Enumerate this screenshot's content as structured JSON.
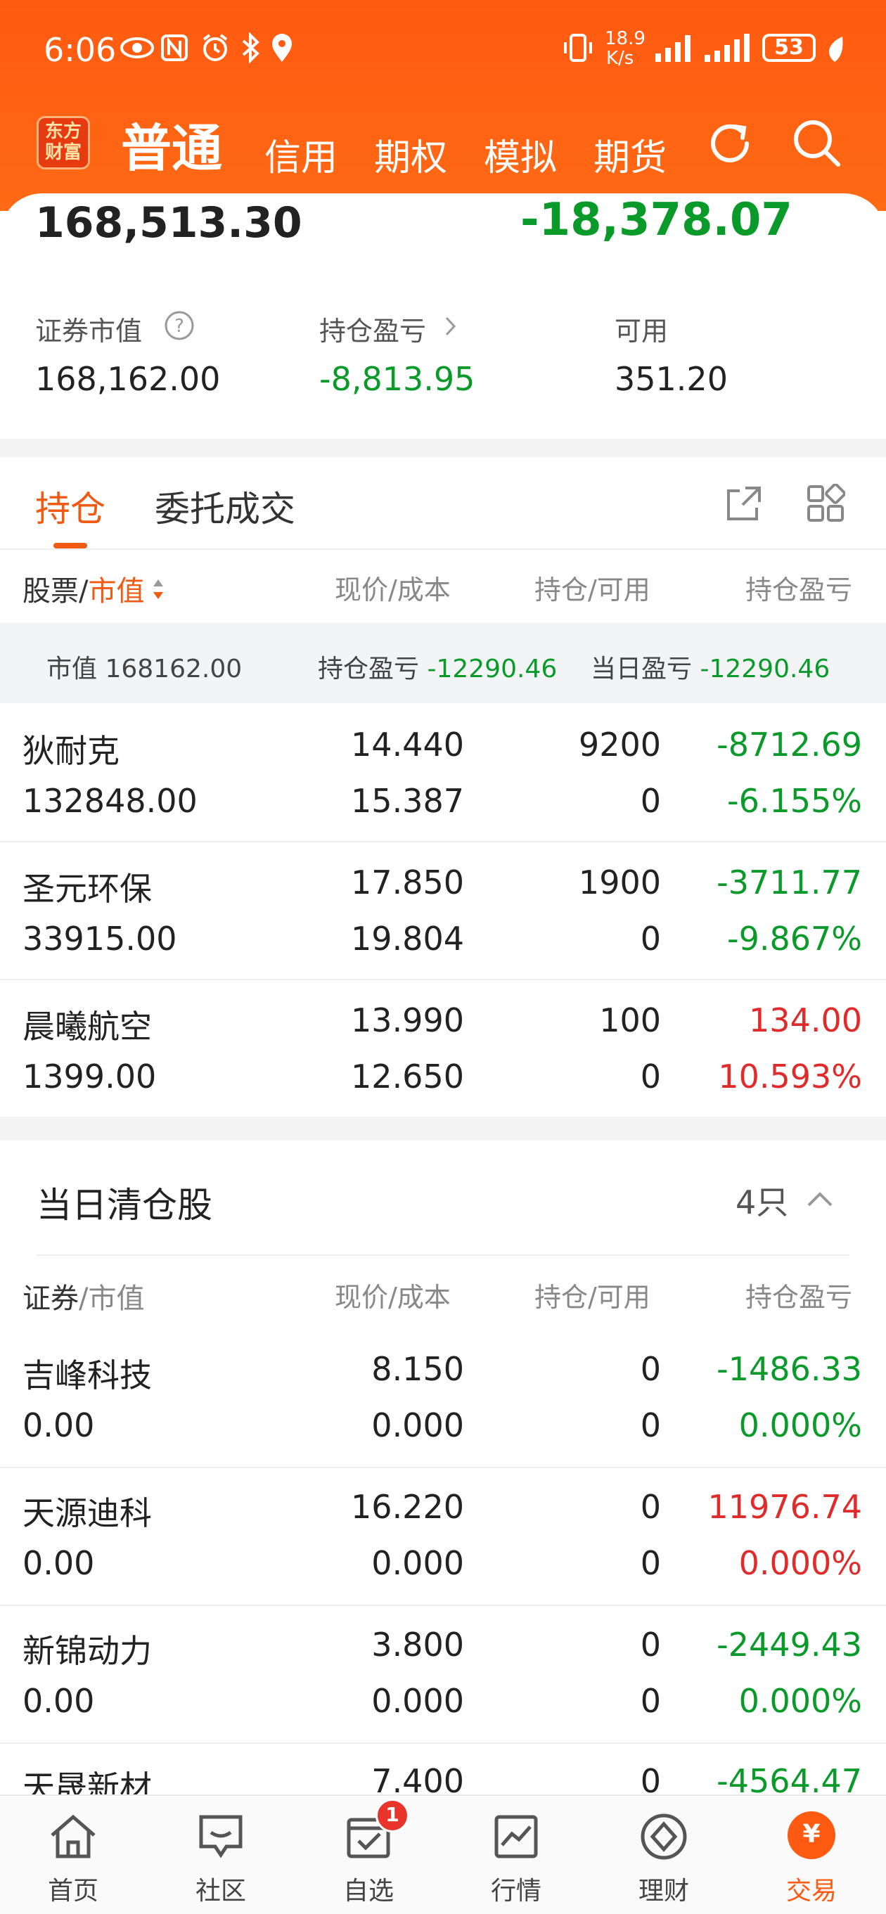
{
  "status_bar": {
    "time": "6:06",
    "net_speed_top": "18.9",
    "net_speed_bottom": "K/s",
    "battery": "53"
  },
  "nav": {
    "logo_line1": "东方",
    "logo_line2": "财富",
    "tabs": [
      "普通",
      "信用",
      "期权",
      "模拟",
      "期货"
    ]
  },
  "summary": {
    "total_assets": "168,513.30",
    "day_pnl": "-18,378.07",
    "market_value_label": "证券市值",
    "market_value": "168,162.00",
    "position_pnl_label": "持仓盈亏",
    "position_pnl": "-8,813.95",
    "available_label": "可用",
    "available": "351.20"
  },
  "tabs": {
    "holdings": "持仓",
    "orders": "委托成交"
  },
  "holdings_header": {
    "col1_a": "股票",
    "col1_sep": "/",
    "col1_b": "市值",
    "col2": "现价/成本",
    "col3": "持仓/可用",
    "col4": "持仓盈亏"
  },
  "holdings_summary": {
    "mv_label": "市值",
    "mv": "168162.00",
    "pos_label": "持仓盈亏",
    "pos": "-12290.46",
    "day_label": "当日盈亏",
    "day": "-12290.46"
  },
  "holdings": [
    {
      "name": "狄耐克",
      "market_value": "132848.00",
      "price": "14.440",
      "cost": "15.387",
      "qty": "9200",
      "avail": "0",
      "pnl": "-8712.69",
      "pnl_pct": "-6.155%"
    },
    {
      "name": "圣元环保",
      "market_value": "33915.00",
      "price": "17.850",
      "cost": "19.804",
      "qty": "1900",
      "avail": "0",
      "pnl": "-3711.77",
      "pnl_pct": "-9.867%"
    },
    {
      "name": "晨曦航空",
      "market_value": "1399.00",
      "price": "13.990",
      "cost": "12.650",
      "qty": "100",
      "avail": "0",
      "pnl": "134.00",
      "pnl_pct": "10.593%"
    }
  ],
  "cleared": {
    "title": "当日清仓股",
    "count": "4只",
    "header": {
      "col1_a": "证券",
      "col1_sep": "/",
      "col1_b": "市值",
      "col2": "现价/成本",
      "col3": "持仓/可用",
      "col4": "持仓盈亏"
    },
    "rows": [
      {
        "name": "吉峰科技",
        "market_value": "0.00",
        "price": "8.150",
        "cost": "0.000",
        "qty": "0",
        "avail": "0",
        "pnl": "-1486.33",
        "pnl_pct": "0.000%"
      },
      {
        "name": "天源迪科",
        "market_value": "0.00",
        "price": "16.220",
        "cost": "0.000",
        "qty": "0",
        "avail": "0",
        "pnl": "11976.74",
        "pnl_pct": "0.000%"
      },
      {
        "name": "新锦动力",
        "market_value": "0.00",
        "price": "3.800",
        "cost": "0.000",
        "qty": "0",
        "avail": "0",
        "pnl": "-2449.43",
        "pnl_pct": "0.000%"
      },
      {
        "name": "天晟新材",
        "price": "7.400",
        "qty": "0",
        "pnl": "-4564.47"
      }
    ]
  },
  "bottom_nav": {
    "items": [
      "首页",
      "社区",
      "自选",
      "行情",
      "理财",
      "交易"
    ],
    "badge": "1",
    "active_symbol": "¥"
  },
  "colors": {
    "brand": "#ff5a12",
    "gain": "#e02b2b",
    "loss": "#0a9a2a"
  }
}
